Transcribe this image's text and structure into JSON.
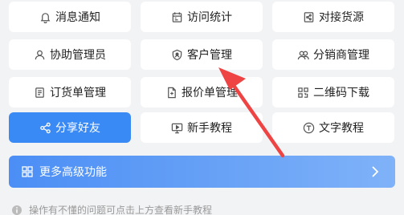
{
  "buttons": [
    {
      "label": "消息通知",
      "icon": "bell-icon"
    },
    {
      "label": "访问统计",
      "icon": "calendar-icon"
    },
    {
      "label": "对接货源",
      "icon": "share-file-icon"
    },
    {
      "label": "协助管理员",
      "icon": "user-icon"
    },
    {
      "label": "客户管理",
      "icon": "shield-icon"
    },
    {
      "label": "分销商管理",
      "icon": "group-icon"
    },
    {
      "label": "订货单管理",
      "icon": "document-icon"
    },
    {
      "label": "报价单管理",
      "icon": "quote-icon"
    },
    {
      "label": "二维码下载",
      "icon": "qrcode-icon"
    },
    {
      "label": "分享好友",
      "icon": "share-icon"
    },
    {
      "label": "新手教程",
      "icon": "monitor-icon"
    },
    {
      "label": "文字教程",
      "icon": "text-icon"
    }
  ],
  "banner": {
    "label": "更多高级功能"
  },
  "hint": {
    "text": "操作有不懂的问题可点击上方查看新手教程"
  },
  "colors": {
    "primary": "#3a8af5",
    "arrow": "#ee4444"
  }
}
